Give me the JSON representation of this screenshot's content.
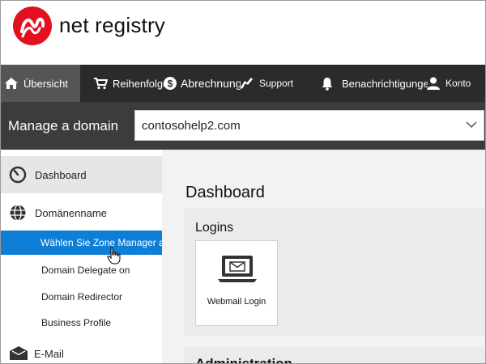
{
  "brand": {
    "name": "net registry"
  },
  "topnav": {
    "items": [
      {
        "label": "Übersicht",
        "icon": "home-icon",
        "active": true
      },
      {
        "label": "Reihenfolge",
        "icon": "cart-icon"
      },
      {
        "label": "Abrechnung",
        "icon": "dollar-icon"
      },
      {
        "label": "Support",
        "icon": "support-icon"
      },
      {
        "label": "Benachrichtigungen",
        "icon": "bell-icon"
      },
      {
        "label": "Konto",
        "icon": "user-icon"
      }
    ]
  },
  "domainbar": {
    "title": "Manage a domain",
    "selected_domain": "contosohelp2.com"
  },
  "sidebar": {
    "dashboard": "Dashboard",
    "domain_name": "Domänenname",
    "subitems": [
      "Wählen Sie Zone Manager aus",
      "Domain Delegate on",
      "Domain Redirector",
      "Business Profile"
    ],
    "email": "E-Mail"
  },
  "main": {
    "title": "Dashboard",
    "panel_logins": "Logins",
    "tile_webmail": "Webmail Login",
    "panel_admin": "Administration"
  },
  "colors": {
    "nav_bg": "#2b2b2b",
    "domain_bar_bg": "#3c3c3c",
    "selected_blue": "#0f7fd6",
    "logo_red": "#e3101f"
  }
}
